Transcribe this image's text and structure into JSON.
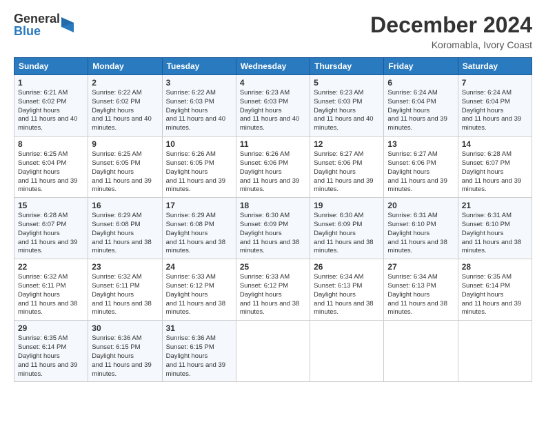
{
  "logo": {
    "general": "General",
    "blue": "Blue"
  },
  "title": {
    "month": "December 2024",
    "location": "Koromabla, Ivory Coast"
  },
  "days": [
    "Sunday",
    "Monday",
    "Tuesday",
    "Wednesday",
    "Thursday",
    "Friday",
    "Saturday"
  ],
  "weeks": [
    [
      {
        "day": "1",
        "rise": "6:21 AM",
        "set": "6:02 PM",
        "light": "11 hours and 40 minutes."
      },
      {
        "day": "2",
        "rise": "6:22 AM",
        "set": "6:02 PM",
        "light": "11 hours and 40 minutes."
      },
      {
        "day": "3",
        "rise": "6:22 AM",
        "set": "6:03 PM",
        "light": "11 hours and 40 minutes."
      },
      {
        "day": "4",
        "rise": "6:23 AM",
        "set": "6:03 PM",
        "light": "11 hours and 40 minutes."
      },
      {
        "day": "5",
        "rise": "6:23 AM",
        "set": "6:03 PM",
        "light": "11 hours and 40 minutes."
      },
      {
        "day": "6",
        "rise": "6:24 AM",
        "set": "6:04 PM",
        "light": "11 hours and 39 minutes."
      },
      {
        "day": "7",
        "rise": "6:24 AM",
        "set": "6:04 PM",
        "light": "11 hours and 39 minutes."
      }
    ],
    [
      {
        "day": "8",
        "rise": "6:25 AM",
        "set": "6:04 PM",
        "light": "11 hours and 39 minutes."
      },
      {
        "day": "9",
        "rise": "6:25 AM",
        "set": "6:05 PM",
        "light": "11 hours and 39 minutes."
      },
      {
        "day": "10",
        "rise": "6:26 AM",
        "set": "6:05 PM",
        "light": "11 hours and 39 minutes."
      },
      {
        "day": "11",
        "rise": "6:26 AM",
        "set": "6:06 PM",
        "light": "11 hours and 39 minutes."
      },
      {
        "day": "12",
        "rise": "6:27 AM",
        "set": "6:06 PM",
        "light": "11 hours and 39 minutes."
      },
      {
        "day": "13",
        "rise": "6:27 AM",
        "set": "6:06 PM",
        "light": "11 hours and 39 minutes."
      },
      {
        "day": "14",
        "rise": "6:28 AM",
        "set": "6:07 PM",
        "light": "11 hours and 39 minutes."
      }
    ],
    [
      {
        "day": "15",
        "rise": "6:28 AM",
        "set": "6:07 PM",
        "light": "11 hours and 39 minutes."
      },
      {
        "day": "16",
        "rise": "6:29 AM",
        "set": "6:08 PM",
        "light": "11 hours and 38 minutes."
      },
      {
        "day": "17",
        "rise": "6:29 AM",
        "set": "6:08 PM",
        "light": "11 hours and 38 minutes."
      },
      {
        "day": "18",
        "rise": "6:30 AM",
        "set": "6:09 PM",
        "light": "11 hours and 38 minutes."
      },
      {
        "day": "19",
        "rise": "6:30 AM",
        "set": "6:09 PM",
        "light": "11 hours and 38 minutes."
      },
      {
        "day": "20",
        "rise": "6:31 AM",
        "set": "6:10 PM",
        "light": "11 hours and 38 minutes."
      },
      {
        "day": "21",
        "rise": "6:31 AM",
        "set": "6:10 PM",
        "light": "11 hours and 38 minutes."
      }
    ],
    [
      {
        "day": "22",
        "rise": "6:32 AM",
        "set": "6:11 PM",
        "light": "11 hours and 38 minutes."
      },
      {
        "day": "23",
        "rise": "6:32 AM",
        "set": "6:11 PM",
        "light": "11 hours and 38 minutes."
      },
      {
        "day": "24",
        "rise": "6:33 AM",
        "set": "6:12 PM",
        "light": "11 hours and 38 minutes."
      },
      {
        "day": "25",
        "rise": "6:33 AM",
        "set": "6:12 PM",
        "light": "11 hours and 38 minutes."
      },
      {
        "day": "26",
        "rise": "6:34 AM",
        "set": "6:13 PM",
        "light": "11 hours and 38 minutes."
      },
      {
        "day": "27",
        "rise": "6:34 AM",
        "set": "6:13 PM",
        "light": "11 hours and 38 minutes."
      },
      {
        "day": "28",
        "rise": "6:35 AM",
        "set": "6:14 PM",
        "light": "11 hours and 39 minutes."
      }
    ],
    [
      {
        "day": "29",
        "rise": "6:35 AM",
        "set": "6:14 PM",
        "light": "11 hours and 39 minutes."
      },
      {
        "day": "30",
        "rise": "6:36 AM",
        "set": "6:15 PM",
        "light": "11 hours and 39 minutes."
      },
      {
        "day": "31",
        "rise": "6:36 AM",
        "set": "6:15 PM",
        "light": "11 hours and 39 minutes."
      },
      null,
      null,
      null,
      null
    ]
  ]
}
